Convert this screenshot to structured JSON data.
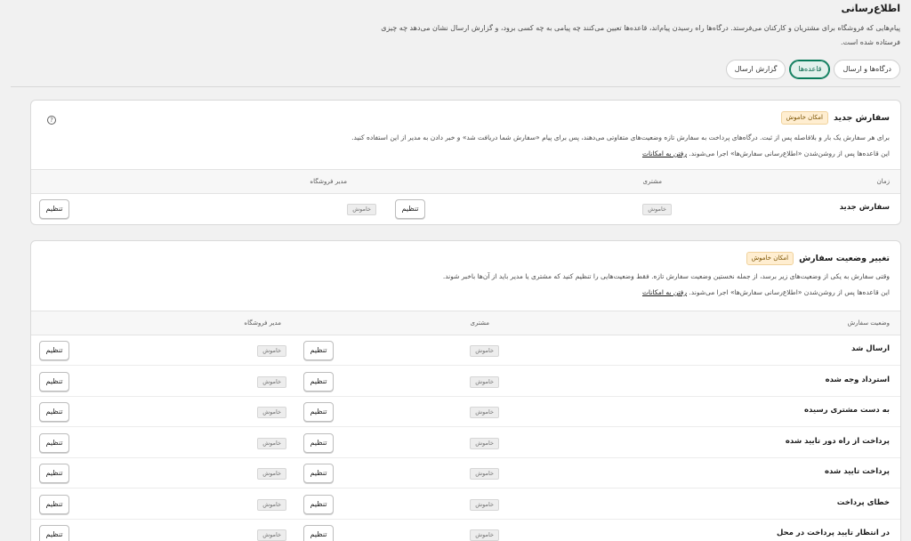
{
  "page": {
    "title": "اطلاع‌رسانی",
    "description": "پیام‌هایی که فروشگاه برای مشتریان و کارکنان می‌فرستد. درگاه‌ها راه رسیدن پیام‌اند، قاعده‌ها تعیین می‌کنند چه پیامی به چه کسی برود، و گزارش ارسال نشان می‌دهد چه چیزی فرستاده شده است."
  },
  "tabs": [
    {
      "label": "درگاه‌ها و ارسال"
    },
    {
      "label": "قاعده‌ها"
    },
    {
      "label": "گزارش ارسال"
    }
  ],
  "new_order": {
    "title": "سفارش جدید",
    "badge": "امکان خاموش",
    "description": "برای هر سفارش یک بار و بلافاصله پس از ثبت. درگاه‌های پرداخت به سفارش تازه وضعیت‌های متفاوتی می‌دهند، پس برای پیام «سفارش شما دریافت شد» و خبر دادن به مدیر از این استفاده کنید.",
    "note": "این قاعده‌ها پس از روشن‌شدن «اطلاع‌رسانی سفارش‌ها» اجرا می‌شوند.",
    "note_link": "رفتن به امکانات",
    "help_icon": "?",
    "columns": {
      "time": "زمان",
      "customer": "مشتری",
      "admin": "مدیر فروشگاه"
    },
    "rows": [
      {
        "label": "سفارش جدید",
        "customer_status": "خاموش",
        "customer_action": "تنظیم",
        "admin_status": "خاموش",
        "admin_action": "تنظیم"
      }
    ]
  },
  "status_change": {
    "title": "تغییر وضعیت سفارش",
    "badge": "امکان خاموش",
    "description": "وقتی سفارش به یکی از وضعیت‌های زیر برسد، از جمله نخستین وضعیت سفارش تازه. فقط وضعیت‌هایی را تنظیم کنید که مشتری یا مدیر باید از آن‌ها باخبر شوند.",
    "note": "این قاعده‌ها پس از روشن‌شدن «اطلاع‌رسانی سفارش‌ها» اجرا می‌شوند.",
    "note_link": "رفتن به امکانات",
    "columns": {
      "status": "وضعیت سفارش",
      "customer": "مشتری",
      "admin": "مدیر فروشگاه"
    },
    "rows": [
      {
        "label": "ارسال شد",
        "customer_status": "خاموش",
        "customer_action": "تنظیم",
        "admin_status": "خاموش",
        "admin_action": "تنظیم"
      },
      {
        "label": "استرداد وجه شده",
        "customer_status": "خاموش",
        "customer_action": "تنظیم",
        "admin_status": "خاموش",
        "admin_action": "تنظیم"
      },
      {
        "label": "به دست مشتری رسیده",
        "customer_status": "خاموش",
        "customer_action": "تنظیم",
        "admin_status": "خاموش",
        "admin_action": "تنظیم"
      },
      {
        "label": "پرداخت از راه دور تایید شده",
        "customer_status": "خاموش",
        "customer_action": "تنظیم",
        "admin_status": "خاموش",
        "admin_action": "تنظیم"
      },
      {
        "label": "پرداخت تایید شده",
        "customer_status": "خاموش",
        "customer_action": "تنظیم",
        "admin_status": "خاموش",
        "admin_action": "تنظیم"
      },
      {
        "label": "خطای پرداخت",
        "customer_status": "خاموش",
        "customer_action": "تنظیم",
        "admin_status": "خاموش",
        "admin_action": "تنظیم"
      },
      {
        "label": "در انتظار تایید پرداخت در محل",
        "customer_status": "خاموش",
        "customer_action": "تنظیم",
        "admin_status": "خاموش",
        "admin_action": "تنظیم"
      }
    ]
  }
}
